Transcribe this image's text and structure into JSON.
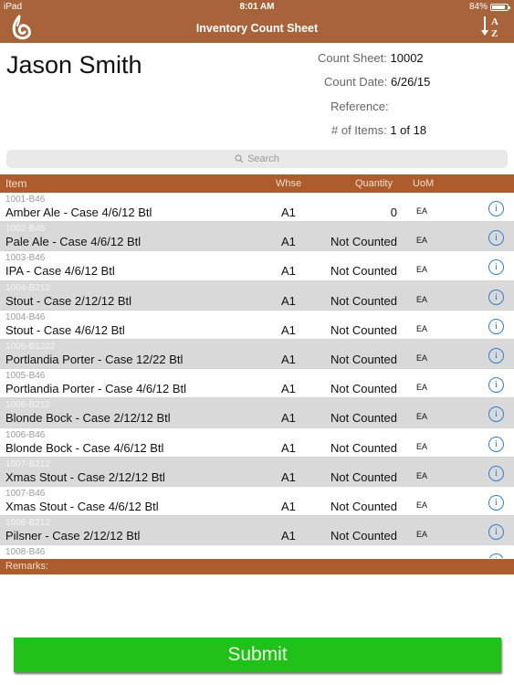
{
  "status_bar": {
    "carrier": "iPad",
    "time": "8:01 AM",
    "battery": "84%"
  },
  "nav": {
    "title": "Inventory Count Sheet",
    "logo_icon": "flame-logo-icon",
    "sort_icon": "sort-a-z-icon"
  },
  "header": {
    "name": "Jason Smith",
    "count_sheet_label": "Count Sheet:",
    "count_sheet_value": "10002",
    "count_date_label": "Count Date:",
    "count_date_value": "6/26/15",
    "reference_label": "Reference:",
    "reference_value": "",
    "items_label": "# of Items:",
    "items_value": "1 of 18"
  },
  "search": {
    "placeholder": "Search"
  },
  "table": {
    "columns": {
      "item": "Item",
      "whse": "Whse",
      "quantity": "Quantity",
      "uom": "UoM"
    },
    "rows": [
      {
        "code": "1001-B46",
        "desc": "Amber Ale - Case 4/6/12 Btl",
        "whse": "A1",
        "qty": "0",
        "uom": "EA"
      },
      {
        "code": "1002-B46",
        "desc": "Pale Ale - Case 4/6/12 Btl",
        "whse": "A1",
        "qty": "Not Counted",
        "uom": "EA"
      },
      {
        "code": "1003-B46",
        "desc": "IPA - Case 4/6/12 Btl",
        "whse": "A1",
        "qty": "Not Counted",
        "uom": "EA"
      },
      {
        "code": "1004-B212",
        "desc": "Stout - Case 2/12/12 Btl",
        "whse": "A1",
        "qty": "Not Counted",
        "uom": "EA"
      },
      {
        "code": "1004-B46",
        "desc": "Stout - Case 4/6/12 Btl",
        "whse": "A1",
        "qty": "Not Counted",
        "uom": "EA"
      },
      {
        "code": "1005-B1222",
        "desc": "Portlandia Porter - Case 12/22 Btl",
        "whse": "A1",
        "qty": "Not Counted",
        "uom": "EA"
      },
      {
        "code": "1005-B46",
        "desc": "Portlandia Porter - Case 4/6/12 Btl",
        "whse": "A1",
        "qty": "Not Counted",
        "uom": "EA"
      },
      {
        "code": "1006-B212",
        "desc": "Blonde Bock - Case 2/12/12 Btl",
        "whse": "A1",
        "qty": "Not Counted",
        "uom": "EA"
      },
      {
        "code": "1006-B46",
        "desc": "Blonde Bock - Case 4/6/12 Btl",
        "whse": "A1",
        "qty": "Not Counted",
        "uom": "EA"
      },
      {
        "code": "1007-B212",
        "desc": "Xmas Stout - Case 2/12/12 Btl",
        "whse": "A1",
        "qty": "Not Counted",
        "uom": "EA"
      },
      {
        "code": "1007-B46",
        "desc": "Xmas Stout - Case 4/6/12 Btl",
        "whse": "A1",
        "qty": "Not Counted",
        "uom": "EA"
      },
      {
        "code": "1008-B212",
        "desc": "Pilsner - Case 2/12/12 Btl",
        "whse": "A1",
        "qty": "Not Counted",
        "uom": "EA"
      },
      {
        "code": "1008-B46",
        "desc": "",
        "whse": "",
        "qty": "",
        "uom": ""
      }
    ]
  },
  "remarks": {
    "label": "Remarks:",
    "value": ""
  },
  "submit": {
    "label": "Submit"
  },
  "colors": {
    "brand": "#ad5c2d",
    "submit": "#22c11a",
    "info": "#2f7fd4",
    "alt_row": "#d9d9d9"
  }
}
